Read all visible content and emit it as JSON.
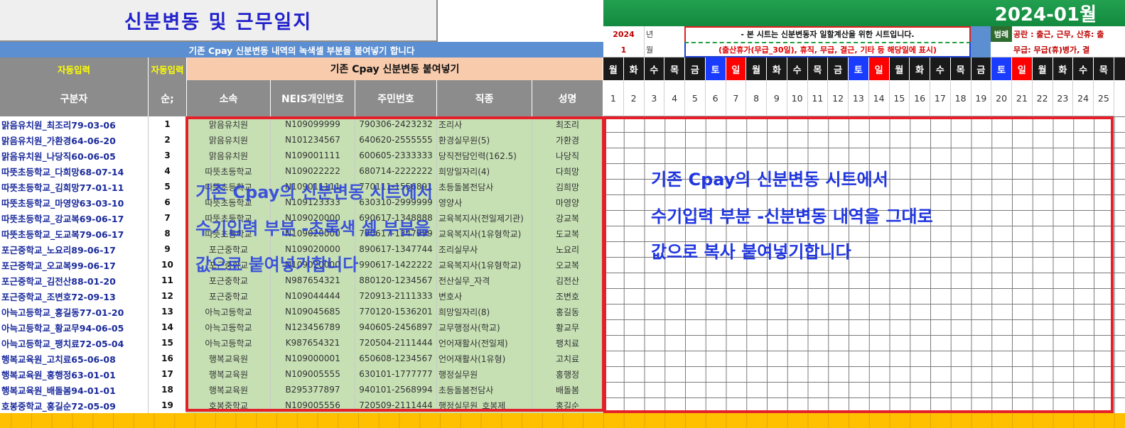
{
  "title": "신분변동 및 근무일지",
  "month_title": "2024-01월",
  "note_bar": "기존 Cpay 신분변동 내역의 녹색셀 부분을 붙여넣기 합니다",
  "header_top": {
    "auto_input_1": "자동입력",
    "auto_input_2": "자동입력",
    "paste_label": "기존 Cpay 신분변동 붙여넣기"
  },
  "columns": [
    "구분자",
    "순;",
    "소속",
    "NEIS개인번호",
    "주민번호",
    "직종",
    "성명"
  ],
  "info": {
    "year_value": "2024",
    "year_label": "년",
    "month_value": "1",
    "month_label": "월",
    "notice_line1": "- 본 시트는 신분변동자 일할계산을 위한 시트입니다.",
    "notice_line2": "(출산휴가(무급_30일), 휴직, 무급, 결근, 기타 등 해당일에 표시)",
    "legend_label": "범례",
    "legend_line1": "공란 : 출근, 근무,  산휴: 출",
    "legend_line2": "무급: 무급(휴)병가, 결"
  },
  "weekdays": [
    "월",
    "화",
    "수",
    "목",
    "금",
    "토",
    "일",
    "월",
    "화",
    "수",
    "목",
    "금",
    "토",
    "일",
    "월",
    "화",
    "수",
    "목",
    "금",
    "토",
    "일",
    "월",
    "화",
    "수",
    "목"
  ],
  "day_numbers": [
    "1",
    "2",
    "3",
    "4",
    "5",
    "6",
    "7",
    "8",
    "9",
    "10",
    "11",
    "12",
    "13",
    "14",
    "15",
    "16",
    "17",
    "18",
    "19",
    "20",
    "21",
    "22",
    "23",
    "24",
    "25"
  ],
  "colors": {
    "weekday": "#1a1a1a",
    "saturday": "#1a3cff",
    "sunday": "#ff0000",
    "green_cell": "#c6e0b4",
    "accent_blue": "#5b8fd1"
  },
  "rows": [
    {
      "key": "맑음유치원_최조리79-03-06",
      "no": "1",
      "org": "맑음유치원",
      "neis": "N109099999",
      "rrn": "790306-2423232",
      "job": "조리사",
      "name": "최조리"
    },
    {
      "key": "맑음유치원_가환경64-06-20",
      "no": "2",
      "org": "맑음유치원",
      "neis": "N101234567",
      "rrn": "640620-2555555",
      "job": "환경실무원(5)",
      "name": "가환경"
    },
    {
      "key": "맑음유치원_나당직60-06-05",
      "no": "3",
      "org": "맑음유치원",
      "neis": "N109001111",
      "rrn": "600605-2333333",
      "job": "당직전담인력(162.5)",
      "name": "나당직"
    },
    {
      "key": "따뜻초등학교_다희망68-07-14",
      "no": "4",
      "org": "따뜻초등학교",
      "neis": "N109022222",
      "rrn": "680714-2222222",
      "job": "희망일자리(4)",
      "name": "다희망"
    },
    {
      "key": "따뜻초등학교_김희망77-01-11",
      "no": "5",
      "org": "따뜻초등학교",
      "neis": "N109011111",
      "rrn": "770111-1556891",
      "job": "초등돌봄전담사",
      "name": "김희망"
    },
    {
      "key": "따뜻초등학교_마영양63-03-10",
      "no": "6",
      "org": "따뜻초등학교",
      "neis": "N109123333",
      "rrn": "630310-2999999",
      "job": "영양사",
      "name": "마영양"
    },
    {
      "key": "따뜻초등학교_강교복69-06-17",
      "no": "7",
      "org": "따뜻초등학교",
      "neis": "N109020000",
      "rrn": "690617-1348888",
      "job": "교육복지사(전일제기관)",
      "name": "강교복"
    },
    {
      "key": "따뜻초등학교_도교복79-06-17",
      "no": "8",
      "org": "따뜻초등학교",
      "neis": "N109020000",
      "rrn": "790617-1347999",
      "job": "교육복지사(1유형학교)",
      "name": "도교복"
    },
    {
      "key": "포근중학교_노요리89-06-17",
      "no": "9",
      "org": "포근중학교",
      "neis": "N109020000",
      "rrn": "890617-1347744",
      "job": "조리실무사",
      "name": "노요리"
    },
    {
      "key": "포근중학교_오교복99-06-17",
      "no": "10",
      "org": "포근중학교",
      "neis": "N109020000",
      "rrn": "990617-1422222",
      "job": "교육복지사(1유형학교)",
      "name": "오교복"
    },
    {
      "key": "포근중학교_김전산88-01-20",
      "no": "11",
      "org": "포근중학교",
      "neis": "N987654321",
      "rrn": "880120-1234567",
      "job": "전산실무_자격",
      "name": "김전산"
    },
    {
      "key": "포근중학교_조변호72-09-13",
      "no": "12",
      "org": "포근중학교",
      "neis": "N109044444",
      "rrn": "720913-2111333",
      "job": "변호사",
      "name": "조변호"
    },
    {
      "key": "아늑고등학교_홍길동77-01-20",
      "no": "13",
      "org": "아늑고등학교",
      "neis": "N109045685",
      "rrn": "770120-1536201",
      "job": "희망일자리(8)",
      "name": "홍길동"
    },
    {
      "key": "아늑고등학교_황교무94-06-05",
      "no": "14",
      "org": "아늑고등학교",
      "neis": "N123456789",
      "rrn": "940605-2456897",
      "job": "교무행정사(학교)",
      "name": "황교무"
    },
    {
      "key": "아늑고등학교_팽치료72-05-04",
      "no": "15",
      "org": "아늑고등학교",
      "neis": "K987654321",
      "rrn": "720504-2111444",
      "job": "언어재활사(전일제)",
      "name": "팽치료"
    },
    {
      "key": "행복교육원_고치료65-06-08",
      "no": "16",
      "org": "행복교육원",
      "neis": "N109000001",
      "rrn": "650608-1234567",
      "job": "언어재활사(1유형)",
      "name": "고치료"
    },
    {
      "key": "행복교육원_홍행정63-01-01",
      "no": "17",
      "org": "행복교육원",
      "neis": "N109005555",
      "rrn": "630101-1777777",
      "job": "행정실무원",
      "name": "홍행정"
    },
    {
      "key": "행복교육원_배돌봄94-01-01",
      "no": "18",
      "org": "행복교육원",
      "neis": "B295377897",
      "rrn": "940101-2568994",
      "job": "초등돌봄전담사",
      "name": "배돌봄"
    },
    {
      "key": "호봉중학교_홍길순72-05-09",
      "no": "19",
      "org": "호봉중학교",
      "neis": "N109005556",
      "rrn": "720509-2111444",
      "job": "행정실무원_호봉제",
      "name": "홍길순"
    }
  ],
  "overlay_left": [
    "기존 Cpay의 신분변동 시트에서",
    "수기입력 부분 -초록색 셀 부분을",
    "값으로 붙여넣기합니다"
  ],
  "overlay_right": [
    "기존 Cpay의 신분변동 시트에서",
    "수기입력 부분 -신분변동 내역을 그대로",
    "값으로 복사 붙여넣기합니다"
  ]
}
